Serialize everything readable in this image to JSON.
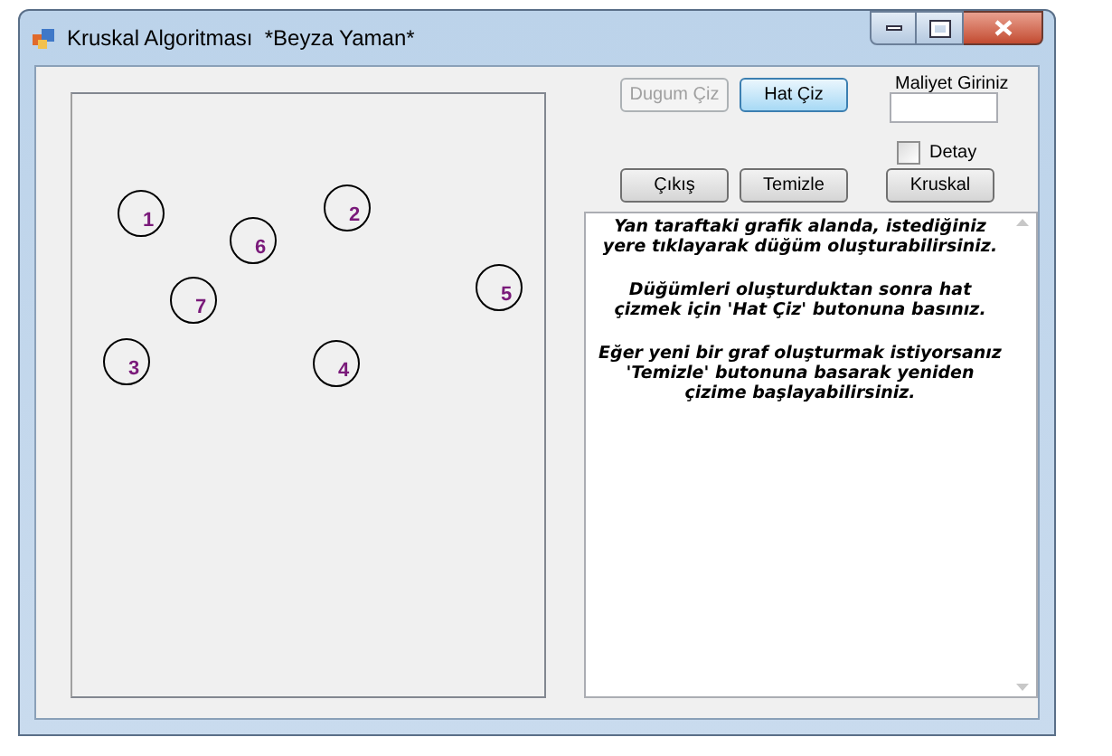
{
  "window": {
    "title": "Kruskal Algoritması  *Beyza Yaman*"
  },
  "canvas": {
    "nodes": [
      {
        "label": "1"
      },
      {
        "label": "6"
      },
      {
        "label": "2"
      },
      {
        "label": "7"
      },
      {
        "label": "5"
      },
      {
        "label": "3"
      },
      {
        "label": "4"
      }
    ]
  },
  "buttons_top": [
    {
      "label": "Dugum Çiz",
      "disabled": true,
      "selected": false
    },
    {
      "label": "Hat Çiz",
      "disabled": false,
      "selected": true
    }
  ],
  "cost_field": {
    "label": "Maliyet Giriniz"
  },
  "detail_checkbox": {
    "label": "Detay",
    "checked": false
  },
  "buttons_bottom": [
    {
      "label": "Çıkış",
      "disabled": false,
      "selected": false
    },
    {
      "label": "Temizle",
      "disabled": false,
      "selected": false
    },
    {
      "label": "Kruskal",
      "disabled": false,
      "selected": false
    }
  ],
  "info_paragraphs": [
    "Yan taraftaki grafik alanda,  istediğiniz yere tıklayarak düğüm oluşturabilirsiniz.",
    "Düğümleri oluşturduktan sonra hat çizmek için 'Hat Çiz' butonuna basınız.",
    "Eğer yeni bir graf oluşturmak istiyorsanız 'Temizle' butonuna basarak yeniden çizime başlayabilirsiniz."
  ]
}
